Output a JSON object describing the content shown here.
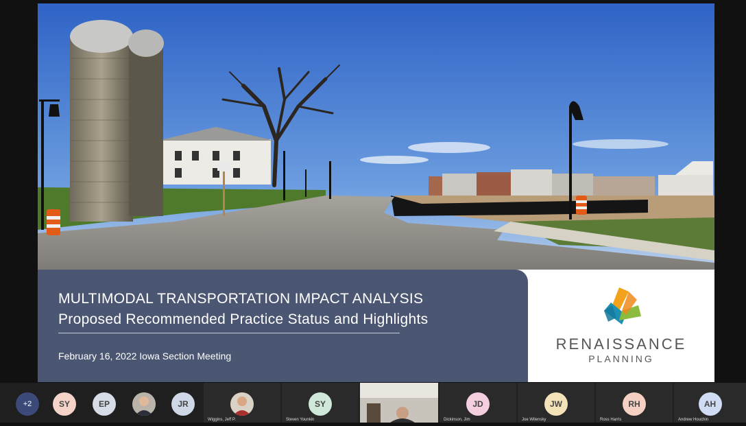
{
  "slide": {
    "title_line1": "MULTIMODAL TRANSPORTATION IMPACT ANALYSIS",
    "title_line2": "Proposed Recommended Practice Status and Highlights",
    "date_line": "February 16, 2022 Iowa Section Meeting",
    "brand_name": "RENAISSANCE",
    "brand_sub": "PLANNING",
    "banner_color": "#4b5672"
  },
  "participants": {
    "overflow_label": "+2",
    "strip_avatars": [
      {
        "initials": "SY",
        "color": "#f6d3c9"
      },
      {
        "initials": "EP",
        "color": "#d7dde6"
      },
      {
        "initials": "",
        "color": "#888"
      },
      {
        "initials": "JR",
        "color": "#cfd8e6"
      }
    ],
    "tiles": [
      {
        "initials": "",
        "name": "Wiggins, Jeff P.",
        "color": "#b55"
      },
      {
        "initials": "SY",
        "name": "Steven Younkin",
        "color": "#cfe8d9"
      },
      {
        "initials": "",
        "name": "",
        "color": ""
      },
      {
        "initials": "JD",
        "name": "Dickinson, Jim",
        "color": "#f3cfe0"
      },
      {
        "initials": "JW",
        "name": "Joe Wilensky",
        "color": "#f4e2b8"
      },
      {
        "initials": "RH",
        "name": "Ross Harris",
        "color": "#f6d0c2"
      },
      {
        "initials": "AH",
        "name": "Andrew Houchin",
        "color": "#cfdcf3"
      }
    ]
  }
}
